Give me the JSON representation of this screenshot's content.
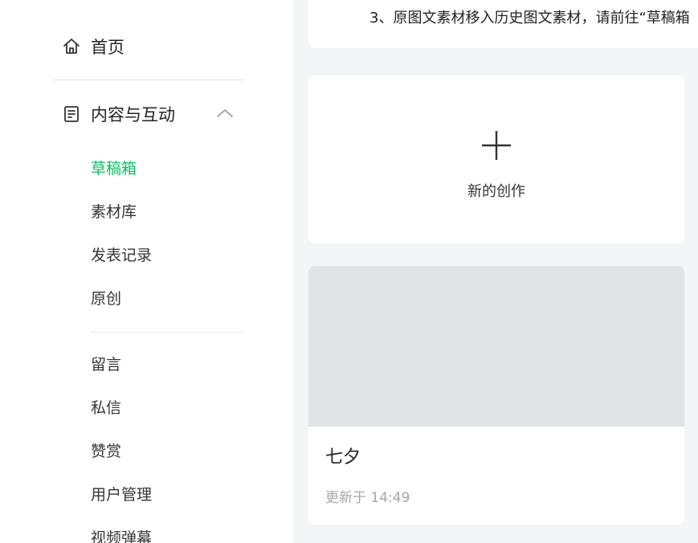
{
  "sidebar": {
    "home_label": "首页",
    "content_label": "内容与互动",
    "sub_items": [
      {
        "label": "草稿箱",
        "active": true
      },
      {
        "label": "素材库"
      },
      {
        "label": "发表记录"
      },
      {
        "label": "原创"
      },
      {
        "label": "留言"
      },
      {
        "label": "私信"
      },
      {
        "label": "赞赏"
      },
      {
        "label": "用户管理"
      },
      {
        "label": "视频弹幕"
      }
    ],
    "icons": {
      "home": "home-icon",
      "content": "document-icon",
      "collapse": "chevron-up-icon"
    }
  },
  "main": {
    "notice_text": "3、原图文素材移入历史图文素材，请前往“草稿箱",
    "new_card": {
      "label": "新的创作",
      "icon": "plus-icon"
    },
    "draft": {
      "title": "七夕",
      "meta": "更新于 14:49"
    }
  },
  "colors": {
    "accent": "#07c160",
    "background": "#f4f5f6",
    "cover": "#e2e3e5",
    "meta": "#a7a7a7"
  }
}
